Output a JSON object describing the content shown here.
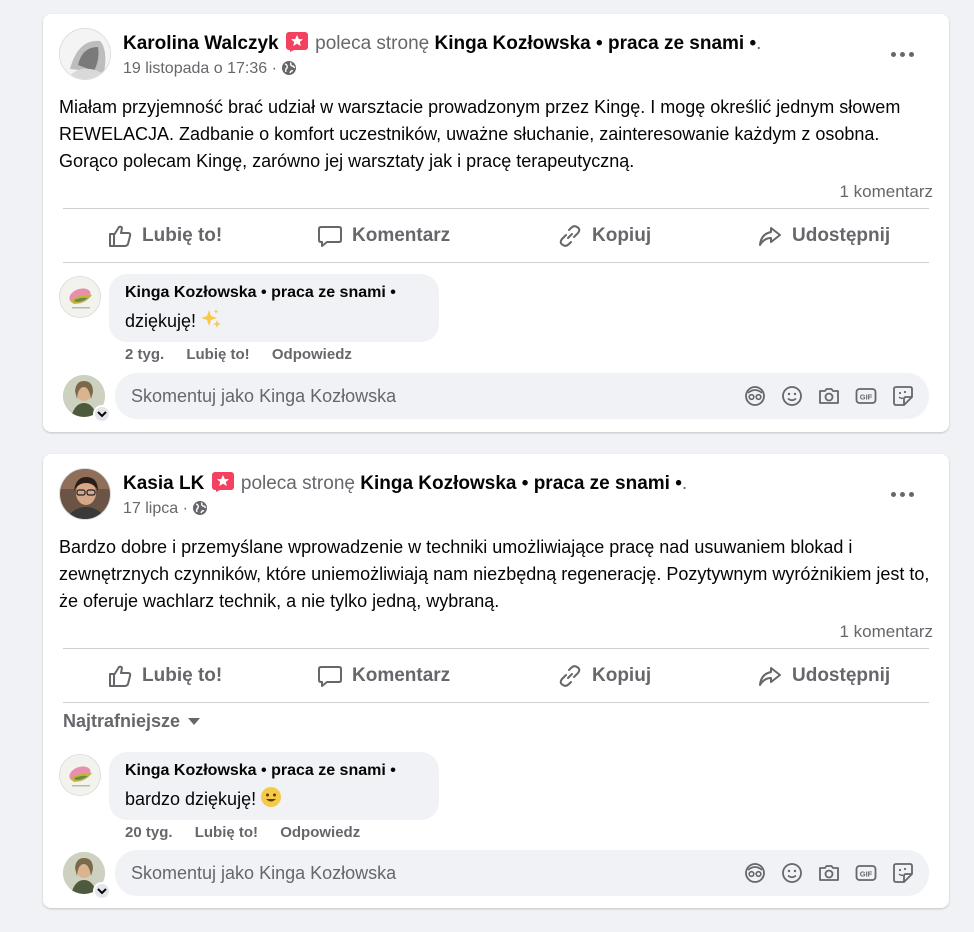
{
  "posts": [
    {
      "author": "Karolina Walczyk",
      "verb": "poleca stronę",
      "page": "Kinga Kozłowska • praca ze snami •",
      "period": ".",
      "date": "19 listopada o 17:36",
      "meta_sep": "·",
      "text": "Miałam przyjemność brać udział w warsztacie prowadzonym przez Kingę. I mogę określić jednym słowem REWELACJA. Zadbanie o komfort uczestników, uważne słuchanie, zainteresowanie każdym z osobna. Gorąco polecam Kingę, zarówno jej warsztaty jak i pracę terapeutyczną.",
      "comment_count": "1 komentarz",
      "actions": {
        "like": "Lubię to!",
        "comment": "Komentarz",
        "copy": "Kopiuj",
        "share": "Udostępnij"
      },
      "comment": {
        "author": "Kinga Kozłowska • praca ze snami •",
        "text": "dziękuję!",
        "emoji": "sparkles",
        "age": "2 tyg.",
        "like": "Lubię to!",
        "reply": "Odpowiedz"
      },
      "composer_placeholder": "Skomentuj jako Kinga Kozłowska"
    },
    {
      "author": "Kasia LK",
      "verb": "poleca stronę",
      "page": "Kinga Kozłowska • praca ze snami •",
      "period": ".",
      "date": "17 lipca",
      "meta_sep": "·",
      "text": "Bardzo dobre i przemyślane wprowadzenie w techniki umożliwiające pracę nad usuwaniem blokad i zewnętrznych czynników, które uniemożliwiają nam niezbędną regenerację. Pozytywnym wyróżnikiem jest to, że oferuje wachlarz technik, a nie tylko jedną, wybraną.",
      "comment_count": "1 komentarz",
      "actions": {
        "like": "Lubię to!",
        "comment": "Komentarz",
        "copy": "Kopiuj",
        "share": "Udostępnij"
      },
      "sort_label": "Najtrafniejsze",
      "comment": {
        "author": "Kinga Kozłowska • praca ze snami •",
        "text": "bardzo dziękuję!",
        "emoji": "smiley",
        "age": "20 tyg.",
        "like": "Lubię to!",
        "reply": "Odpowiedz"
      },
      "composer_placeholder": "Skomentuj jako Kinga Kozłowska"
    }
  ],
  "colors": {
    "background": "#f0f2f5",
    "card": "#ffffff",
    "secondary_text": "#65676b",
    "primary_text": "#050505",
    "recommend_badge": "#f3425f"
  },
  "composer_icons": [
    "avatar-sticker-icon",
    "emoji-icon",
    "camera-icon",
    "gif-icon",
    "sticker-icon"
  ]
}
